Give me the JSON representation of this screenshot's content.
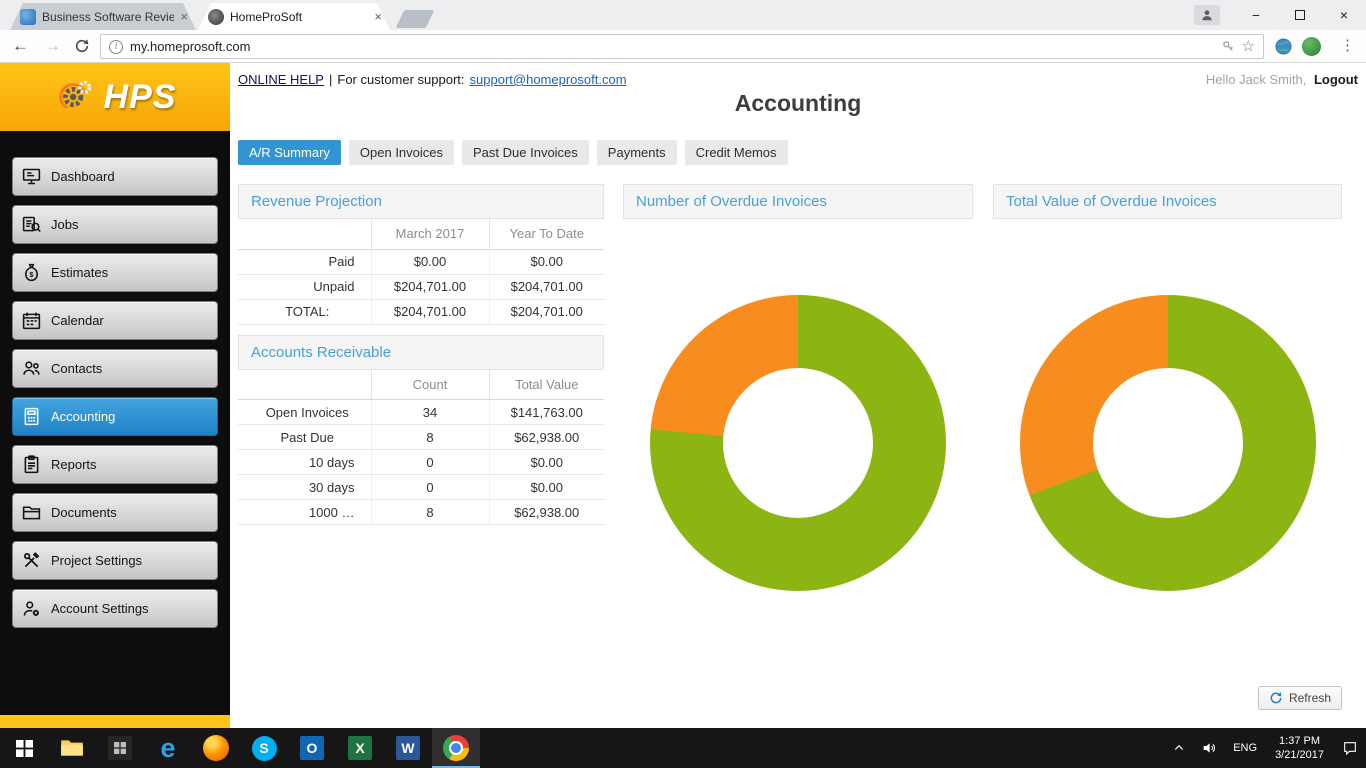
{
  "browser": {
    "tabs": [
      {
        "title": "Business Software Review",
        "close_glyph": "×"
      },
      {
        "title": "HomeProSoft",
        "close_glyph": "×"
      }
    ],
    "nav": {
      "back": "←",
      "forward": "→"
    },
    "url": "my.homeprosoft.com",
    "star_glyph": "☆",
    "menu_glyph": "⋮",
    "window": {
      "minimize_glyph": "−",
      "close_glyph": "×"
    }
  },
  "topbar": {
    "online_help": "ONLINE HELP",
    "separator": "|",
    "support_label": "For customer support:",
    "support_email": "support@homeprosoft.com",
    "greeting": "Hello Jack Smith,",
    "logout": "Logout"
  },
  "page": {
    "title": "Accounting"
  },
  "sidebar": {
    "logo_text": "HPS",
    "items": [
      {
        "label": "Dashboard"
      },
      {
        "label": "Jobs"
      },
      {
        "label": "Estimates"
      },
      {
        "label": "Calendar"
      },
      {
        "label": "Contacts"
      },
      {
        "label": "Accounting",
        "active": true
      },
      {
        "label": "Reports"
      },
      {
        "label": "Documents"
      },
      {
        "label": "Project Settings"
      },
      {
        "label": "Account Settings"
      }
    ]
  },
  "ar_tabs": [
    {
      "label": "A/R Summary",
      "active": true
    },
    {
      "label": "Open Invoices"
    },
    {
      "label": "Past Due Invoices"
    },
    {
      "label": "Payments"
    },
    {
      "label": "Credit Memos"
    }
  ],
  "revenue_projection": {
    "title": "Revenue Projection",
    "columns": [
      "",
      "March 2017",
      "Year To Date"
    ],
    "rows": [
      {
        "label": "Paid",
        "values": [
          "$0.00",
          "$0.00"
        ]
      },
      {
        "label": "Unpaid",
        "values": [
          "$204,701.00",
          "$204,701.00"
        ]
      },
      {
        "label": "TOTAL:",
        "values": [
          "$204,701.00",
          "$204,701.00"
        ]
      }
    ]
  },
  "accounts_receivable": {
    "title": "Accounts Receivable",
    "columns": [
      "",
      "Count",
      "Total Value"
    ],
    "rows": [
      {
        "label": "Open Invoices",
        "values": [
          "34",
          "$141,763.00"
        ]
      },
      {
        "label": "Past Due",
        "values": [
          "8",
          "$62,938.00"
        ]
      },
      {
        "label": "10 days",
        "values": [
          "0",
          "$0.00"
        ]
      },
      {
        "label": "30 days",
        "values": [
          "0",
          "$0.00"
        ]
      },
      {
        "label": "1000 …",
        "values": [
          "8",
          "$62,938.00"
        ]
      }
    ]
  },
  "chart_data": [
    {
      "type": "pie",
      "variant": "donut",
      "title": "Number of Overdue Invoices",
      "values": [
        26,
        8
      ],
      "colors": [
        "#8cb513",
        "#f68d1e"
      ],
      "start": "top",
      "direction": "clockwise",
      "legend": "none"
    },
    {
      "type": "pie",
      "variant": "donut",
      "title": "Total Value of Overdue Invoices",
      "values": [
        141763,
        62938
      ],
      "colors": [
        "#8cb513",
        "#f68d1e"
      ],
      "start": "top",
      "direction": "clockwise",
      "legend": "none"
    }
  ],
  "refresh_button": {
    "label": "Refresh"
  },
  "taskbar": {
    "apps": [
      {
        "glyph": "e"
      },
      {
        "glyph": "S"
      },
      {
        "glyph": "O"
      },
      {
        "glyph": "X"
      },
      {
        "glyph": "W"
      }
    ],
    "lang": "ENG",
    "time": "1:37 PM",
    "date": "3/21/2017"
  },
  "theme": {
    "accent_blue": "#3095d2",
    "brand_yellow": "#ffc417",
    "chart_green": "#8cb513",
    "chart_orange": "#f68d1e"
  }
}
